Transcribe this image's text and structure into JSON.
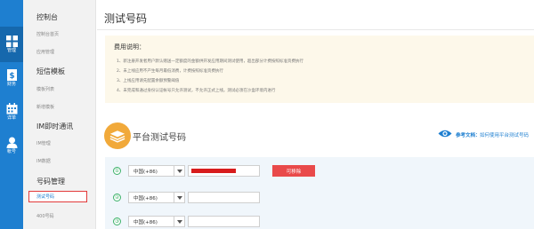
{
  "rail": [
    {
      "icon": "grid-icon",
      "label": "管理"
    },
    {
      "icon": "dollar-doc-icon",
      "label": "财务"
    },
    {
      "icon": "calendar-icon",
      "label": "详单"
    },
    {
      "icon": "person-icon",
      "label": "帐号"
    }
  ],
  "nav": {
    "groups": [
      {
        "title": "控制台",
        "items": [
          "控制台首页",
          "应用管理"
        ]
      },
      {
        "title": "短信模板",
        "items": [
          "模板列表",
          "新增模板"
        ]
      },
      {
        "title": "IM即时通讯",
        "items": [
          "IM管理",
          "IM数据"
        ]
      },
      {
        "title": "号码管理",
        "items": [
          "测试号码",
          "400号码"
        ]
      }
    ]
  },
  "main": {
    "page_title": "测试号码",
    "fee": {
      "title": "费用说明：",
      "lines": [
        "1、新注册开发者用户默认赠送一定额度的金额供开发应用期间测试使用，超出部分计费按照标准资费执行",
        "2、未上线应用不产生每月最低消费，计费按照标准资费执行",
        "3、上线应用请先配置余额预警阈值",
        "4、未完成和通过身份认证帐号只允许测试，不允许正式上线。测试必须在沙盒环境内进行"
      ]
    },
    "platform_title": "平台测试号码",
    "doc_label": "参考文档：",
    "doc_link": "如何使用平台测试号码",
    "rows": [
      {
        "num": "①",
        "country_code": "中国(+86)",
        "remove_label": "可移除",
        "has_value": true
      },
      {
        "num": "②",
        "country_code": "中国(+86)",
        "has_value": false
      },
      {
        "num": "③",
        "country_code": "中国(+86)",
        "has_value": false
      }
    ]
  },
  "colors": {
    "rail_bg": "#1e7fd0",
    "accent": "#1e7fd0",
    "remove": "#e94a4a",
    "highlight_border": "#e23a3a",
    "logo": "#f1a93a",
    "row_num": "#3db26a"
  }
}
